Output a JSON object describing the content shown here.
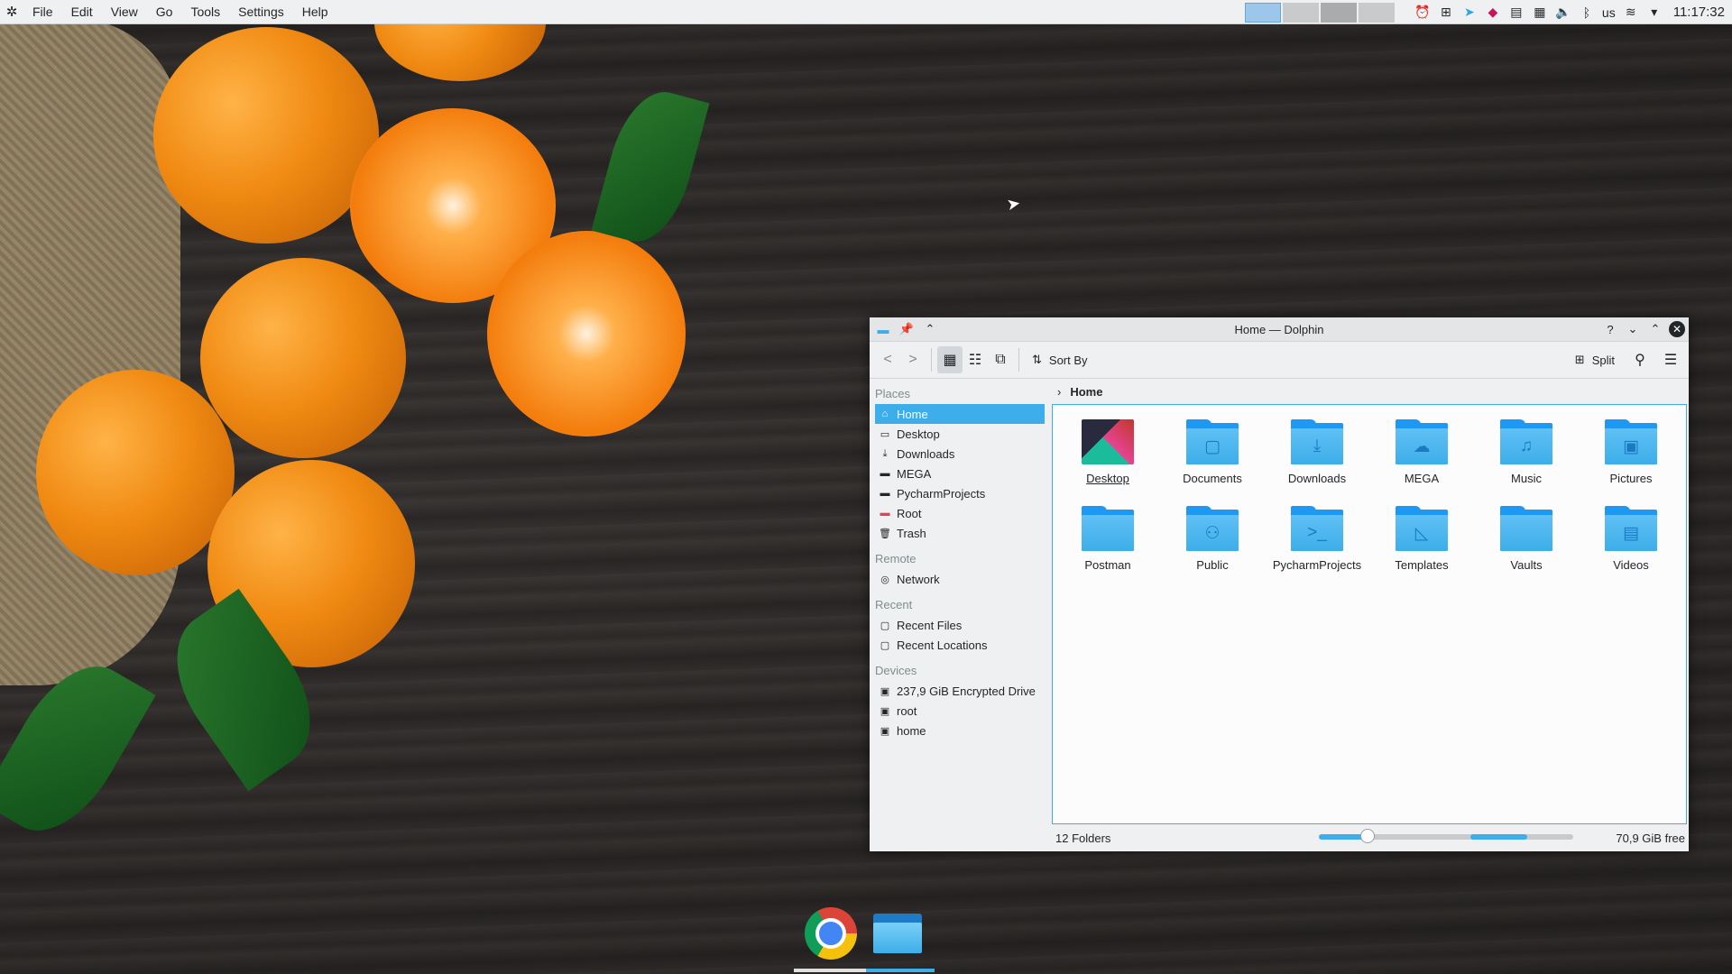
{
  "menubar": {
    "items": [
      "File",
      "Edit",
      "View",
      "Go",
      "Tools",
      "Settings",
      "Help"
    ]
  },
  "tray": {
    "keyboard_layout": "us",
    "clock": "11:17:32",
    "icons": [
      "alarm-icon",
      "network-grid-icon",
      "telegram-icon",
      "app-cube-icon",
      "clipboard-icon",
      "devices-icon",
      "volume-icon",
      "bluetooth-icon",
      "wifi-icon",
      "tray-expand-icon"
    ]
  },
  "window": {
    "title": "Home — Dolphin",
    "toolbar": {
      "sort_label": "Sort By",
      "split_label": "Split"
    },
    "breadcrumb": {
      "current": "Home"
    },
    "sidebar": {
      "places_header": "Places",
      "places": [
        {
          "label": "Home",
          "icon": "home-icon"
        },
        {
          "label": "Desktop",
          "icon": "desktop-icon"
        },
        {
          "label": "Downloads",
          "icon": "download-icon"
        },
        {
          "label": "MEGA",
          "icon": "folder-icon"
        },
        {
          "label": "PycharmProjects",
          "icon": "folder-icon"
        },
        {
          "label": "Root",
          "icon": "folder-red-icon"
        },
        {
          "label": "Trash",
          "icon": "trash-icon"
        }
      ],
      "remote_header": "Remote",
      "remote": [
        {
          "label": "Network",
          "icon": "network-icon"
        }
      ],
      "recent_header": "Recent",
      "recent": [
        {
          "label": "Recent Files",
          "icon": "recent-files-icon"
        },
        {
          "label": "Recent Locations",
          "icon": "recent-locations-icon"
        }
      ],
      "devices_header": "Devices",
      "devices": [
        {
          "label": "237,9 GiB Encrypted Drive",
          "icon": "encrypted-drive-icon"
        },
        {
          "label": "root",
          "icon": "drive-icon"
        },
        {
          "label": "home",
          "icon": "drive-icon"
        }
      ]
    },
    "folders": [
      {
        "label": "Desktop",
        "glyph": ""
      },
      {
        "label": "Documents",
        "glyph": "▢"
      },
      {
        "label": "Downloads",
        "glyph": "⤓"
      },
      {
        "label": "MEGA",
        "glyph": "☁"
      },
      {
        "label": "Music",
        "glyph": "♫"
      },
      {
        "label": "Pictures",
        "glyph": "▣"
      },
      {
        "label": "Postman",
        "glyph": ""
      },
      {
        "label": "Public",
        "glyph": "⚇"
      },
      {
        "label": "PycharmProjects",
        "glyph": ">_"
      },
      {
        "label": "Templates",
        "glyph": "◺"
      },
      {
        "label": "Vaults",
        "glyph": ""
      },
      {
        "label": "Videos",
        "glyph": "▤"
      }
    ],
    "status": {
      "count": "12 Folders",
      "free": "70,9 GiB free",
      "disk_used_fraction": 0.55
    }
  },
  "dock": {
    "items": [
      "chrome-icon",
      "file-manager-icon"
    ]
  },
  "colors": {
    "accent": "#3daee9",
    "folder": "#1d99f3",
    "panel": "#eff0f1"
  }
}
